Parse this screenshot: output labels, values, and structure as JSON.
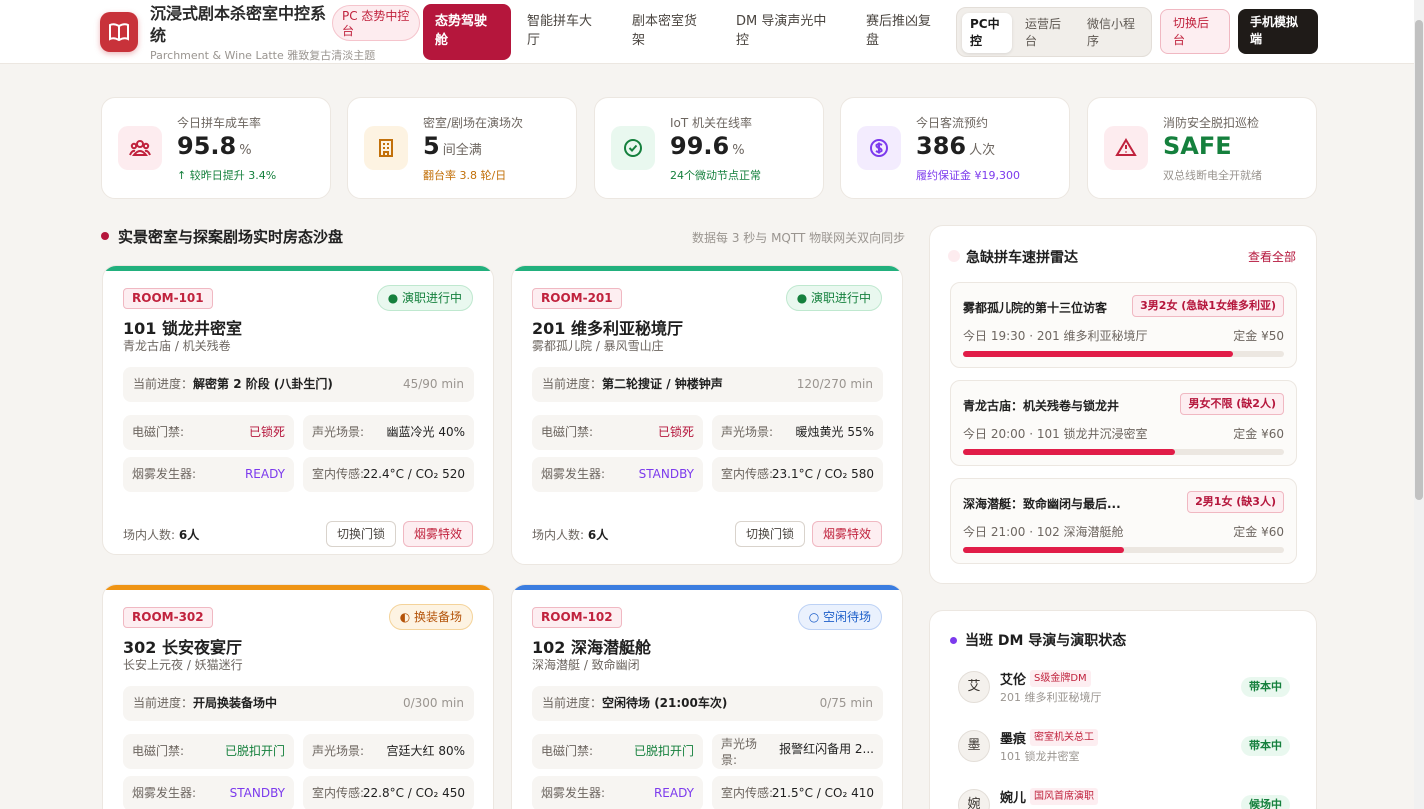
{
  "header": {
    "title": "沉浸式剧本杀密室中控系统",
    "subtitle": "Parchment & Wine Latte 雅致复古清淡主题",
    "pc_badge": "PC 态势中控台",
    "nav": [
      "态势驾驶舱",
      "智能拼车大厅",
      "剧本密室货架",
      "DM 导演声光中控",
      "赛后推凶复盘"
    ],
    "segments": [
      "PC中控",
      "运营后台",
      "微信小程序"
    ],
    "switch_back": "切换后台",
    "mobile_sim": "手机模拟端"
  },
  "kpis": [
    {
      "label": "今日拼车成车率",
      "value": "95.8",
      "unit": "%",
      "sub": "↑ 较昨日提升 3.4%",
      "sub_color": "#15803d",
      "icon": "users-icon",
      "tint": "#fdecef",
      "ink": "#c0223d"
    },
    {
      "label": "密室/剧场在演场次",
      "value": "5",
      "unit": "间全满",
      "sub": "翻台率 3.8 轮/日",
      "sub_color": "#c2700a",
      "icon": "building-icon",
      "tint": "#fdf3e2",
      "ink": "#c2700a"
    },
    {
      "label": "IoT 机关在线率",
      "value": "99.6",
      "unit": "%",
      "sub": "24个微动节点正常",
      "sub_color": "#15803d",
      "icon": "check-circle-icon",
      "tint": "#e9f8ef",
      "ink": "#15803d"
    },
    {
      "label": "今日客流预约",
      "value": "386",
      "unit": "人次",
      "sub": "履约保证金 ¥19,300",
      "sub_color": "#7c3aed",
      "icon": "dollar-icon",
      "tint": "#f3ecfe",
      "ink": "#7c3aed"
    },
    {
      "label": "消防安全脱扣巡检",
      "value": "SAFE",
      "unit": "",
      "sub": "双总线断电全开就绪",
      "sub_color": "#9a9590",
      "icon": "warning-icon",
      "tint": "#fdecef",
      "ink": "#c0223d"
    }
  ],
  "rooms_section": {
    "title": "实景密室与探案剧场实时房态沙盘",
    "note": "数据每 3 秒与 MQTT 物联网关双向同步"
  },
  "rooms": [
    {
      "code": "ROOM-101",
      "status": "● 演职进行中",
      "status_kind": "live",
      "bar_color": "#22b07d",
      "name": "101 锁龙井密室",
      "sub": "青龙古庙 / 机关残卷",
      "progress_label": "当前进度：",
      "progress": "解密第 2 阶段 (八卦生门)",
      "time": "45/90 min",
      "door_label": "电磁门禁:",
      "door": "已锁死",
      "door_kind": "locked",
      "light_label": "声光场景:",
      "light": "幽蓝冷光 40%",
      "smoke_label": "烟雾发生器:",
      "smoke": "READY",
      "sensor_label": "室内传感:",
      "sensor": "22.4°C / CO₂ 520",
      "occ_label": "场内人数:",
      "occ": "6人",
      "btn_door": "切换门锁",
      "btn_smoke": "烟雾特效"
    },
    {
      "code": "ROOM-201",
      "status": "● 演职进行中",
      "status_kind": "live",
      "bar_color": "#22b07d",
      "name": "201 维多利亚秘境厅",
      "sub": "雾都孤儿院 / 暴风雪山庄",
      "progress_label": "当前进度：",
      "progress": "第二轮搜证 / 钟楼钟声",
      "time": "120/270 min",
      "door_label": "电磁门禁:",
      "door": "已锁死",
      "door_kind": "locked",
      "light_label": "声光场景:",
      "light": "暖烛黄光 55%",
      "smoke_label": "烟雾发生器:",
      "smoke": "STANDBY",
      "sensor_label": "室内传感:",
      "sensor": "23.1°C / CO₂ 580",
      "occ_label": "场内人数:",
      "occ": "6人",
      "btn_door": "切换门锁",
      "btn_smoke": "烟雾特效"
    },
    {
      "code": "ROOM-302",
      "status": "◐ 换装备场",
      "status_kind": "prep",
      "bar_color": "#ef9414",
      "name": "302 长安夜宴厅",
      "sub": "长安上元夜 / 妖猫迷行",
      "progress_label": "当前进度：",
      "progress": "开局换装备场中",
      "time": "0/300 min",
      "door_label": "电磁门禁:",
      "door": "已脱扣开门",
      "door_kind": "open",
      "light_label": "声光场景:",
      "light": "宫廷大红 80%",
      "smoke_label": "烟雾发生器:",
      "smoke": "STANDBY",
      "sensor_label": "室内传感:",
      "sensor": "22.8°C / CO₂ 450"
    },
    {
      "code": "ROOM-102",
      "status": "○ 空闲待场",
      "status_kind": "idle",
      "bar_color": "#3b7de0",
      "name": "102 深海潜艇舱",
      "sub": "深海潜艇 / 致命幽闭",
      "progress_label": "当前进度：",
      "progress": "空闲待场 (21:00车次)",
      "time": "0/75 min",
      "door_label": "电磁门禁:",
      "door": "已脱扣开门",
      "door_kind": "open",
      "light_label": "声光场景:",
      "light": "报警红闪备用 2...",
      "smoke_label": "烟雾发生器:",
      "smoke": "READY",
      "sensor_label": "室内传感:",
      "sensor": "21.5°C / CO₂ 410"
    }
  ],
  "radar": {
    "title": "急缺拼车速拼雷达",
    "view_all": "查看全部",
    "items": [
      {
        "title": "雾都孤儿院的第十三位访客",
        "tag": "3男2女 (急缺1女维多利亚)",
        "time": "今日 19:30 · 201 维多利亚秘境厅",
        "deposit": "定金 ¥50",
        "fill": 0.84
      },
      {
        "title": "青龙古庙：机关残卷与锁龙井",
        "tag": "男女不限 (缺2人)",
        "time": "今日 20:00 · 101 锁龙井沉浸密室",
        "deposit": "定金 ¥60",
        "fill": 0.66
      },
      {
        "title": "深海潜艇：致命幽闭与最后...",
        "tag": "2男1女 (缺3人)",
        "time": "今日 21:00 · 102 深海潜艇舱",
        "deposit": "定金 ¥60",
        "fill": 0.5
      }
    ]
  },
  "dm_panel": {
    "title": "当班 DM 导演与演职状态",
    "items": [
      {
        "avatar": "艾",
        "name": "艾伦",
        "tag": "S级金牌DM",
        "room": "201 维多利亚秘境厅",
        "state": "带本中"
      },
      {
        "avatar": "墨",
        "name": "墨痕",
        "tag": "密室机关总工",
        "room": "101 锁龙井密室",
        "state": "带本中"
      },
      {
        "avatar": "婉",
        "name": "婉儿",
        "tag": "国风首席演职",
        "room": "",
        "state": "候场中"
      }
    ]
  },
  "colors": {
    "accent": "#b5163c",
    "live": "#22b07d",
    "prep": "#ef9414",
    "idle": "#3b7de0"
  }
}
